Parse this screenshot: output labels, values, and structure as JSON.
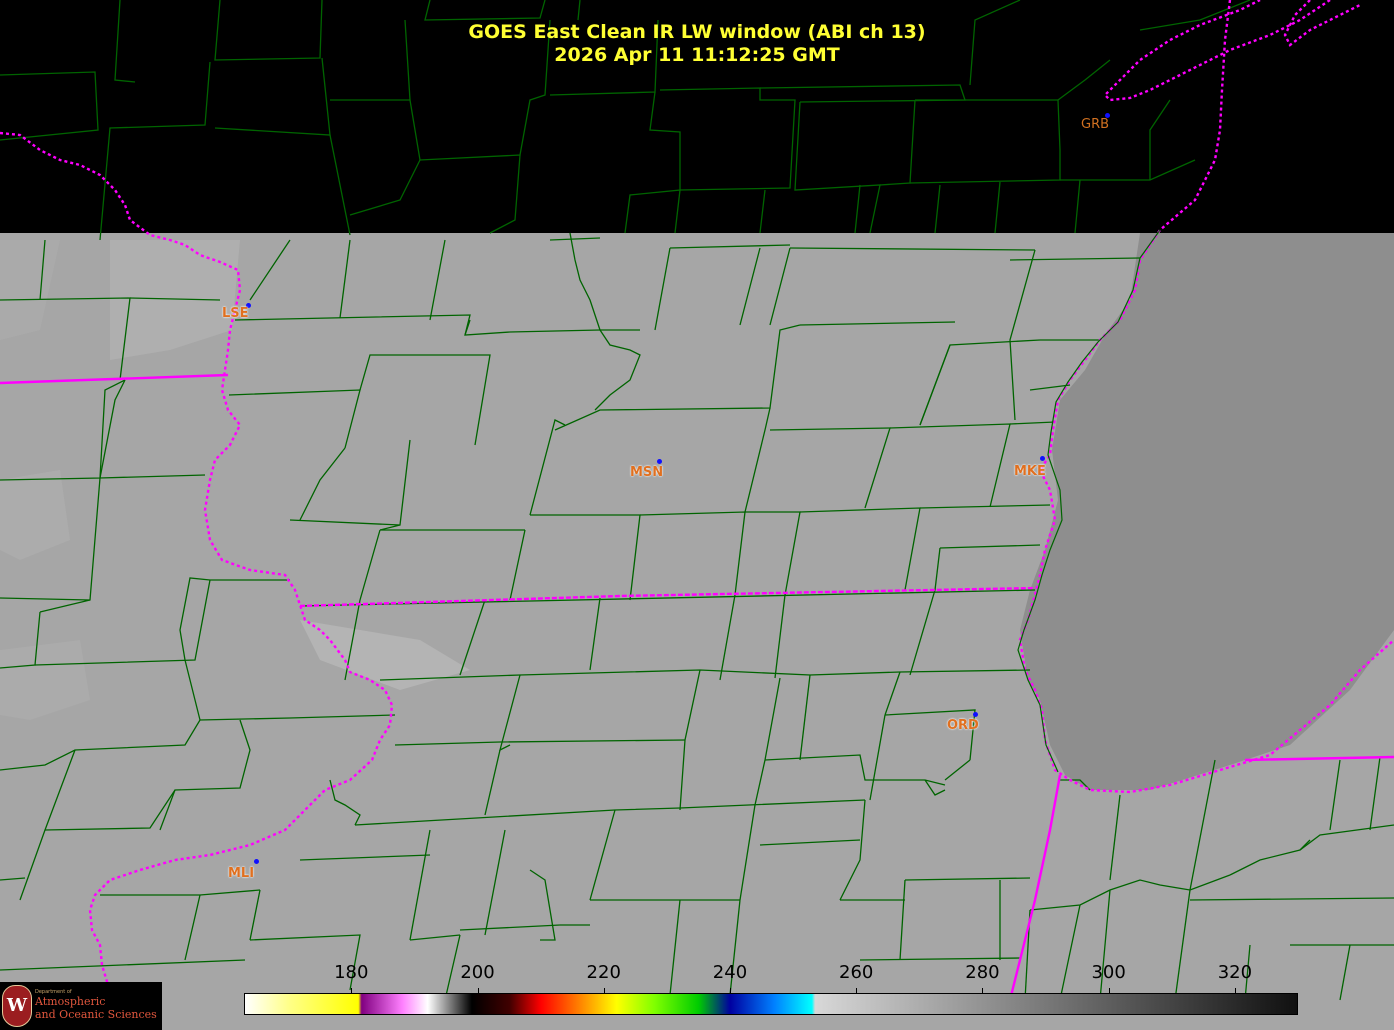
{
  "title": {
    "line1": "GOES East Clean IR LW window (ABI ch 13)",
    "line2": "2026 Apr 11  11:12:25 GMT"
  },
  "stations": [
    {
      "code": "GRB",
      "style": "plain"
    },
    {
      "code": "LSE",
      "style": "halo"
    },
    {
      "code": "MSN",
      "style": "halo"
    },
    {
      "code": "MKE",
      "style": "halo"
    },
    {
      "code": "ORD",
      "style": "halo"
    },
    {
      "code": "MLI",
      "style": "halo"
    }
  ],
  "colorbar": {
    "ticks": [
      "180",
      "200",
      "220",
      "240",
      "260",
      "280",
      "300",
      "320"
    ],
    "tick_values": [
      180,
      200,
      220,
      240,
      260,
      280,
      300,
      320
    ],
    "range": [
      163,
      330
    ],
    "stops": [
      {
        "v": 163,
        "c": "#ffffff"
      },
      {
        "v": 170,
        "c": "#ffff88"
      },
      {
        "v": 181,
        "c": "#ffff00"
      },
      {
        "v": 181.5,
        "c": "#800080"
      },
      {
        "v": 188,
        "c": "#ff80ff"
      },
      {
        "v": 192,
        "c": "#ffffff"
      },
      {
        "v": 199,
        "c": "#000000"
      },
      {
        "v": 205,
        "c": "#400000"
      },
      {
        "v": 210,
        "c": "#ff0000"
      },
      {
        "v": 216,
        "c": "#ff8000"
      },
      {
        "v": 222,
        "c": "#ffff00"
      },
      {
        "v": 228,
        "c": "#80ff00"
      },
      {
        "v": 235,
        "c": "#00cc00"
      },
      {
        "v": 240,
        "c": "#0000a0"
      },
      {
        "v": 247,
        "c": "#0080ff"
      },
      {
        "v": 253,
        "c": "#00ffff"
      },
      {
        "v": 253.5,
        "c": "#d8d8d8"
      },
      {
        "v": 330,
        "c": "#101010"
      }
    ]
  },
  "logo": {
    "seal": "W",
    "dept": "Department of",
    "line1": "Atmospheric",
    "line2": "and Oceanic Sciences"
  },
  "colors": {
    "land": "#a6a6a6",
    "lake": "#8d8d8d",
    "county": "#006400",
    "state": "#ff00ff",
    "title": "#ffff33",
    "station_text": "#e07020",
    "station_dot": "#1010ff"
  }
}
